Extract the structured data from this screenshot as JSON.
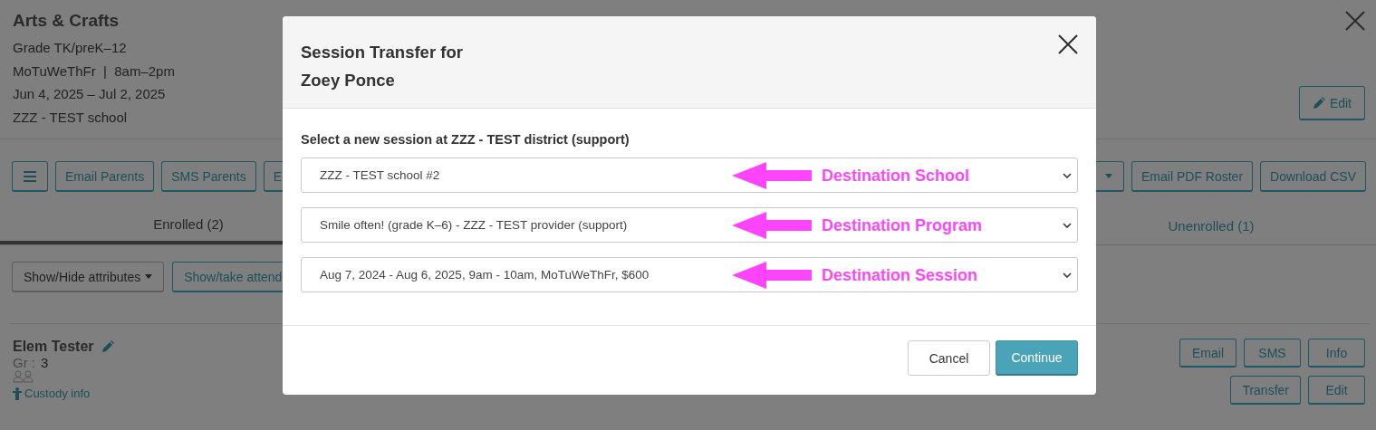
{
  "header": {
    "title": "Arts & Crafts",
    "lines": [
      "Grade TK/preK–12",
      "MoTuWeThFr  |  8am–2pm",
      "Jun 4, 2025 – Jul 2, 2025",
      "ZZZ - TEST school"
    ],
    "edit_button": "Edit"
  },
  "toolbar": {
    "left": [
      {
        "kind": "menu"
      },
      {
        "kind": "text",
        "label": "Email Parents"
      },
      {
        "kind": "text",
        "label": "SMS Parents"
      },
      {
        "kind": "text",
        "label": "E"
      }
    ],
    "right": [
      {
        "kind": "caret"
      },
      {
        "kind": "text",
        "label": "Email PDF Roster"
      },
      {
        "kind": "text",
        "label": "Download CSV"
      }
    ]
  },
  "tabs": [
    {
      "label": "Enrolled (2)",
      "selected": true
    },
    {
      "label": "Unenrolled (1)",
      "selected": false
    }
  ],
  "actions": [
    {
      "kind": "dropdown",
      "label": "Show/Hide attributes"
    },
    {
      "kind": "text",
      "label": "Show/take attend"
    }
  ],
  "student": {
    "name": "Elem Tester",
    "grade_label": "Gr :",
    "grade": "3",
    "custody_link": "Custody info",
    "buttons": [
      [
        "Email",
        "SMS",
        "Info"
      ],
      [
        "Transfer",
        "Edit"
      ]
    ]
  },
  "modal": {
    "title": "Session Transfer for Zoey Ponce",
    "prompt": "Select a new session at ZZZ - TEST district (support)",
    "selects": [
      {
        "value": "ZZZ - TEST school #2",
        "annotation": "Destination School"
      },
      {
        "value": "Smile often! (grade K–6) - ZZZ  - TEST provider (support)",
        "annotation": "Destination Program"
      },
      {
        "value": "Aug 7, 2024 - Aug 6, 2025, 9am - 10am, MoTuWeThFr, $600",
        "annotation": "Destination Session"
      }
    ],
    "buttons": [
      {
        "label": "Cancel",
        "kind": "default"
      },
      {
        "label": "Continue",
        "kind": "primary"
      }
    ]
  }
}
